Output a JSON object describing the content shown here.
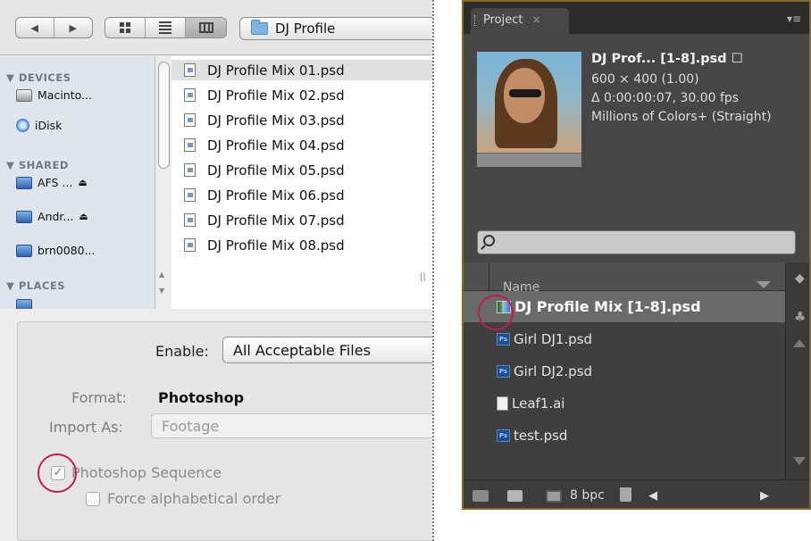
{
  "mac_dialog": {
    "toolbar": {
      "back_icon": "triangle-left",
      "forward_icon": "triangle-right",
      "path_label": "DJ Profile"
    },
    "sidebar": {
      "devices_heading": "▼ DEVICES",
      "shared_heading": "▼ SHARED",
      "places_heading": "▼ PLACES",
      "devices": [
        {
          "label": "Macinto...",
          "icon": "hard-drive-icon"
        },
        {
          "label": "iDisk",
          "icon": "idisk-icon"
        }
      ],
      "shared": [
        {
          "label": "AFS ...",
          "icon": "network-computer-icon",
          "eject": "⏏"
        },
        {
          "label": "Andr...",
          "icon": "network-computer-icon",
          "eject": "⏏"
        },
        {
          "label": "brn0080...",
          "icon": "network-computer-icon"
        }
      ]
    },
    "files": [
      "DJ Profile Mix 01.psd",
      "DJ Profile Mix 02.psd",
      "DJ Profile Mix 03.psd",
      "DJ Profile Mix 04.psd",
      "DJ Profile Mix 05.psd",
      "DJ Profile Mix 06.psd",
      "DJ Profile Mix 07.psd",
      "DJ Profile Mix 08.psd"
    ],
    "selected_file_index": 0,
    "options": {
      "enable_label": "Enable:",
      "enable_value": "All Acceptable Files",
      "format_label": "Format:",
      "format_value": "Photoshop",
      "import_as_label": "Import As:",
      "import_as_value": "Footage",
      "sequence_label": "Photoshop Sequence",
      "sequence_checked": true,
      "alpha_label": "Force alphabetical order",
      "alpha_checked": false
    }
  },
  "ae_panel": {
    "tab_label": "Project",
    "tab_close": "×",
    "panel_menu": "▾≡",
    "info": {
      "name": "DJ Prof... [1-8].psd ☐",
      "size": "600 × 400 (1.00)",
      "duration": "Δ 0:00:00:07, 30.00 fps",
      "colors": "Millions of Colors+ (Straight)"
    },
    "search_placeholder": "",
    "column_name": "Name",
    "items": [
      {
        "label": "DJ Profile Mix [1-8].psd",
        "icon": "image-sequence-icon",
        "selected": true
      },
      {
        "label": "Girl DJ1.psd",
        "icon": "photoshop-file-icon",
        "selected": false
      },
      {
        "label": "Girl DJ2.psd",
        "icon": "photoshop-file-icon",
        "selected": false
      },
      {
        "label": "Leaf1.ai",
        "icon": "illustrator-file-icon",
        "selected": false
      },
      {
        "label": "test.psd",
        "icon": "photoshop-file-icon",
        "selected": false
      }
    ],
    "footer": {
      "bpc": "8 bpc",
      "left_arrow": "◀",
      "right_arrow": "▶"
    }
  },
  "highlight_color": "#c4185c"
}
